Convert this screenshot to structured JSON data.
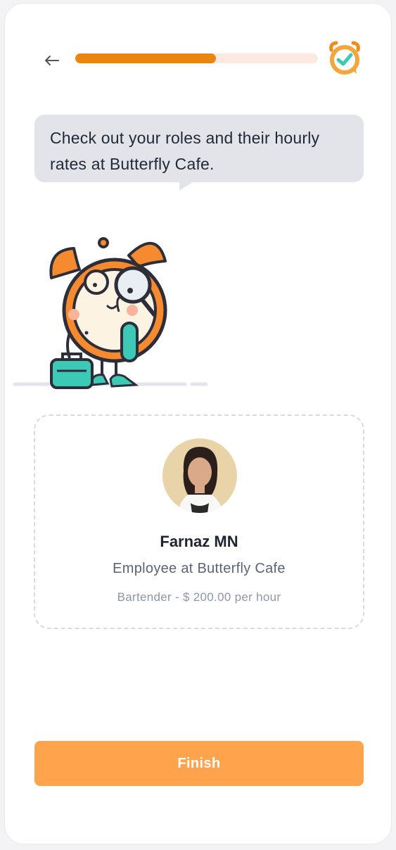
{
  "header": {
    "back_icon": "arrow-left-icon",
    "progress": 0.58,
    "progress_color": "#e8860f",
    "progress_track_color": "#fde9e0",
    "logo_icon": "alarm-clock-check-icon"
  },
  "message": {
    "text": "Check out your roles and their hourly rates at Butterfly Cafe."
  },
  "mascot": {
    "icon": "alarm-clock-character-illustration"
  },
  "profile": {
    "name": "Farnaz MN",
    "role": "Employee at Butterfly Cafe",
    "rate": "Bartender - $ 200.00 per hour"
  },
  "actions": {
    "finish_label": "Finish",
    "finish_color": "#ffa34c"
  }
}
